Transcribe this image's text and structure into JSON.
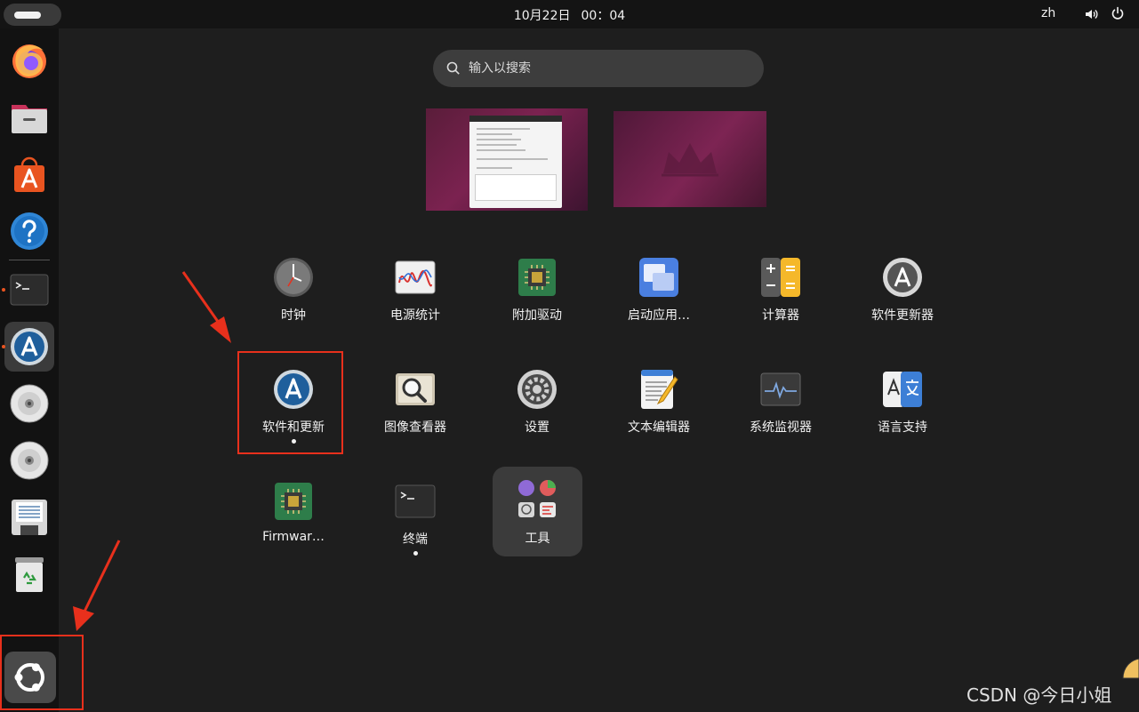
{
  "topbar": {
    "date": "10月22日",
    "time": "00：04",
    "language": "zh"
  },
  "search": {
    "placeholder": "输入以搜索"
  },
  "apps": [
    {
      "id": "clock",
      "label": "时钟",
      "running": false
    },
    {
      "id": "power-stats",
      "label": "电源统计",
      "running": false
    },
    {
      "id": "additional-drivers",
      "label": "附加驱动",
      "running": false
    },
    {
      "id": "startup-apps",
      "label": "启动应用…",
      "running": false
    },
    {
      "id": "calculator",
      "label": "计算器",
      "running": false
    },
    {
      "id": "software-updater",
      "label": "软件更新器",
      "running": false
    },
    {
      "id": "software-properties",
      "label": "软件和更新",
      "running": true
    },
    {
      "id": "image-viewer",
      "label": "图像查看器",
      "running": false
    },
    {
      "id": "settings",
      "label": "设置",
      "running": false
    },
    {
      "id": "text-editor",
      "label": "文本编辑器",
      "running": false
    },
    {
      "id": "system-monitor",
      "label": "系统监视器",
      "running": false
    },
    {
      "id": "language-support",
      "label": "语言支持",
      "running": false
    },
    {
      "id": "firmware",
      "label": "Firmwar…",
      "running": false
    },
    {
      "id": "terminal",
      "label": "终端",
      "running": true
    },
    {
      "id": "tools-folder",
      "label": "工具",
      "running": false
    }
  ],
  "dock": [
    {
      "id": "firefox",
      "icon": "firefox-icon"
    },
    {
      "id": "files",
      "icon": "files-icon"
    },
    {
      "id": "app-center",
      "icon": "app-center-icon"
    },
    {
      "id": "help",
      "icon": "help-icon"
    },
    {
      "id": "terminal",
      "icon": "terminal-icon",
      "running": true
    },
    {
      "id": "software-properties",
      "icon": "software-properties-icon",
      "running": true,
      "active": true
    },
    {
      "id": "cd-1",
      "icon": "cd-icon"
    },
    {
      "id": "cd-2",
      "icon": "cd-icon"
    },
    {
      "id": "floppy",
      "icon": "floppy-icon"
    },
    {
      "id": "trash",
      "icon": "trash-icon"
    },
    {
      "id": "show-apps",
      "icon": "ubuntu-logo-icon"
    }
  ],
  "colors": {
    "accent": "#e95420",
    "annotation": "#e8301c",
    "background": "#1e1e1e",
    "panel": "#141414"
  },
  "watermark": "CSDN @今日小姐"
}
